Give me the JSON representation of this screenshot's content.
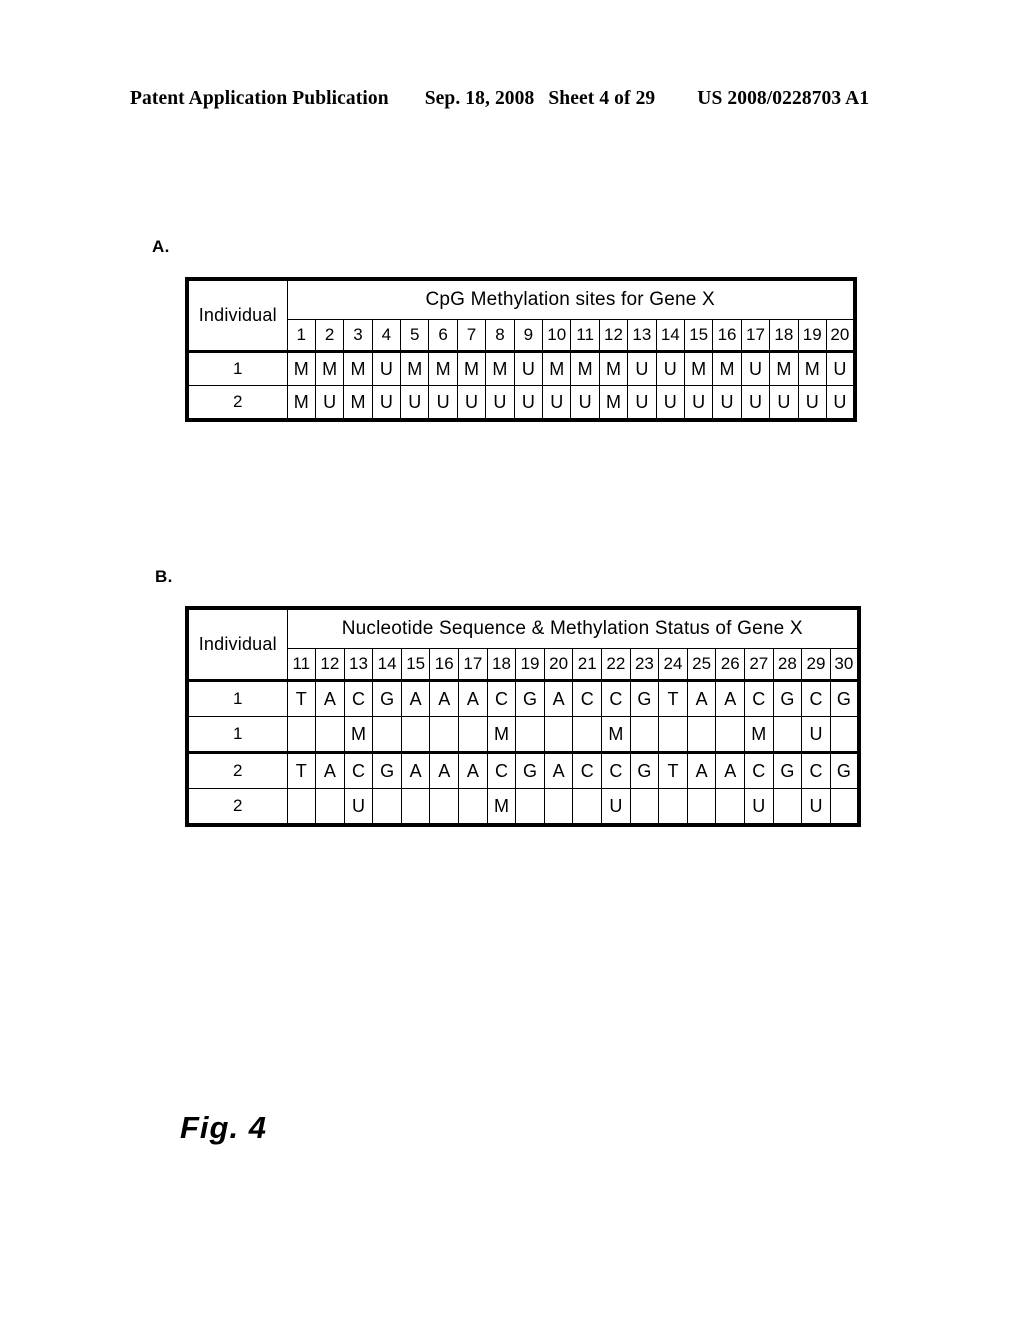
{
  "header": {
    "publication": "Patent Application Publication",
    "date": "Sep. 18, 2008",
    "sheet": "Sheet 4 of 29",
    "patent_number": "US 2008/0228703 A1"
  },
  "figure": {
    "caption": "Fig. 4",
    "panel_a_label": "A.",
    "panel_b_label": "B."
  },
  "panel_a": {
    "individual_header": "Individual",
    "group_header": "CpG Methylation sites for Gene X",
    "site_numbers": [
      "1",
      "2",
      "3",
      "4",
      "5",
      "6",
      "7",
      "8",
      "9",
      "10",
      "11",
      "12",
      "13",
      "14",
      "15",
      "16",
      "17",
      "18",
      "19",
      "20"
    ],
    "rows": [
      {
        "individual": "1",
        "values": [
          "M",
          "M",
          "M",
          "U",
          "M",
          "M",
          "M",
          "M",
          "U",
          "M",
          "M",
          "M",
          "U",
          "U",
          "M",
          "M",
          "U",
          "M",
          "M",
          "U"
        ]
      },
      {
        "individual": "2",
        "values": [
          "M",
          "U",
          "M",
          "U",
          "U",
          "U",
          "U",
          "U",
          "U",
          "U",
          "U",
          "M",
          "U",
          "U",
          "U",
          "U",
          "U",
          "U",
          "U",
          "U"
        ]
      }
    ]
  },
  "panel_b": {
    "individual_header": "Individual",
    "group_header": "Nucleotide Sequence & Methylation Status of Gene X",
    "site_numbers": [
      "11",
      "12",
      "13",
      "14",
      "15",
      "16",
      "17",
      "18",
      "19",
      "20",
      "21",
      "22",
      "23",
      "24",
      "25",
      "26",
      "27",
      "28",
      "29",
      "30"
    ],
    "rows": [
      {
        "individual": "1",
        "kind": "sequence",
        "values": [
          "T",
          "A",
          "C",
          "G",
          "A",
          "A",
          "A",
          "C",
          "G",
          "A",
          "C",
          "C",
          "G",
          "T",
          "A",
          "A",
          "C",
          "G",
          "C",
          "G"
        ]
      },
      {
        "individual": "1",
        "kind": "methylation",
        "values": [
          "",
          "",
          "M",
          "",
          "",
          "",
          "",
          "M",
          "",
          "",
          "",
          "M",
          "",
          "",
          "",
          "",
          "M",
          "",
          "U",
          ""
        ]
      },
      {
        "individual": "2",
        "kind": "sequence",
        "values": [
          "T",
          "A",
          "C",
          "G",
          "A",
          "A",
          "A",
          "C",
          "G",
          "A",
          "C",
          "C",
          "G",
          "T",
          "A",
          "A",
          "C",
          "G",
          "C",
          "G"
        ]
      },
      {
        "individual": "2",
        "kind": "methylation",
        "values": [
          "",
          "",
          "U",
          "",
          "",
          "",
          "",
          "M",
          "",
          "",
          "",
          "U",
          "",
          "",
          "",
          "",
          "U",
          "",
          "U",
          ""
        ]
      }
    ]
  }
}
